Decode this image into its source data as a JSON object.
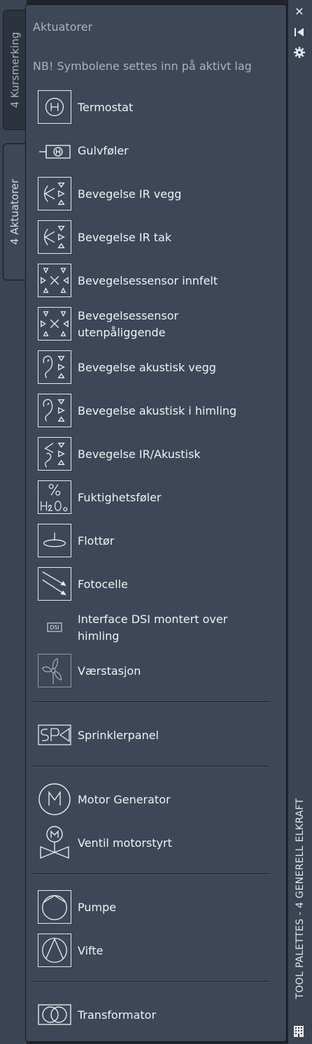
{
  "tabs": [
    {
      "label": "4 Kursmerking",
      "active": false
    },
    {
      "label": "4 Aktuatorer",
      "active": true
    }
  ],
  "panel": {
    "header": "Aktuatorer",
    "note": "NB! Symbolene settes inn på aktivt lag"
  },
  "tools": [
    {
      "label": "Termostat",
      "icon": "thermostat-icon"
    },
    {
      "label": "Gulvføler",
      "icon": "floor-sensor-icon"
    },
    {
      "label": "Bevegelse IR vegg",
      "icon": "motion-ir-wall-icon"
    },
    {
      "label": "Bevegelse IR tak",
      "icon": "motion-ir-ceiling-icon"
    },
    {
      "label": "Bevegelsessensor innfelt",
      "icon": "motion-sensor-recessed-icon"
    },
    {
      "label": "Bevegelsessensor utenpåliggende",
      "icon": "motion-sensor-surface-icon"
    },
    {
      "label": "Bevegelse akustisk vegg",
      "icon": "motion-acoustic-wall-icon"
    },
    {
      "label": "Bevegelse akustisk i himling",
      "icon": "motion-acoustic-ceiling-icon"
    },
    {
      "label": "Bevegelse IR/Akustisk",
      "icon": "motion-ir-acoustic-icon"
    },
    {
      "label": "Fuktighetsføler",
      "icon": "humidity-sensor-icon"
    },
    {
      "label": "Flottør",
      "icon": "float-switch-icon"
    },
    {
      "label": "Fotocelle",
      "icon": "photocell-icon"
    },
    {
      "label": "Interface DSI montert over himling",
      "icon": "dsi-interface-icon"
    },
    {
      "label": "Værstasjon",
      "icon": "weather-station-icon"
    },
    {
      "label": "Sprinklerpanel",
      "icon": "sprinkler-panel-icon"
    },
    {
      "label": "Motor Generator",
      "icon": "motor-generator-icon"
    },
    {
      "label": "Ventil motorstyrt",
      "icon": "motorized-valve-icon"
    },
    {
      "label": "Pumpe",
      "icon": "pump-icon"
    },
    {
      "label": "Vifte",
      "icon": "fan-icon"
    },
    {
      "label": "Transformator",
      "icon": "transformer-icon"
    }
  ],
  "title_bar": {
    "close": "✕",
    "title": "TOOL PALETTES - 4 GENERELL ELKRAFT"
  }
}
